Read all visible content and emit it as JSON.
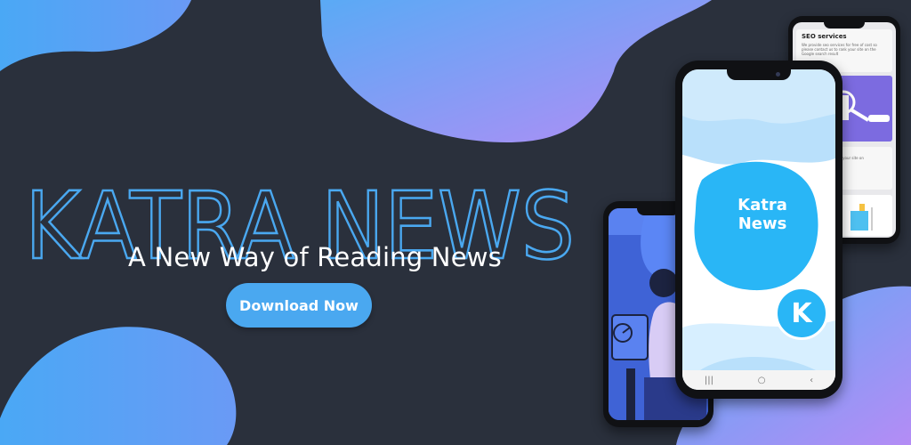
{
  "banner": {
    "title": "KATRA NEWS",
    "tagline": "A New Way of Reading News",
    "cta_label": "Download Now"
  },
  "colors": {
    "background": "#2a303c",
    "title_stroke": "#4aa8f0",
    "button": "#4aa8f0",
    "blob_gradient_start": "#5aaaf5",
    "blob_gradient_end": "#b48cf5"
  },
  "main_phone": {
    "app_name_line1": "Katra",
    "app_name_line2": "News",
    "badge_letter": "K",
    "nav_buttons": [
      "|||",
      "○",
      "‹"
    ]
  },
  "back_phone": {
    "card_title": "SEO services",
    "card_text": "We provide seo services for free of cost so please contact us to rank your site on the Google search result",
    "card2_text": "for free of cost to rank your site on"
  },
  "icons": {
    "left_phone_illustration": "person-reading-illustration-icon",
    "seo_illustration": "magnifier-analytics-illustration-icon"
  }
}
